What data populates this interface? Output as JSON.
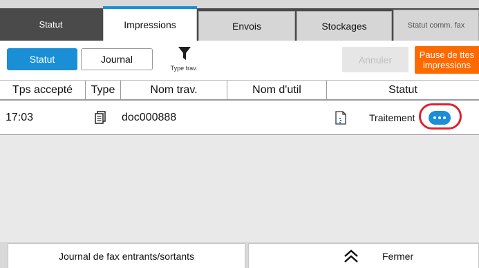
{
  "tabs": [
    {
      "label": "Statut"
    },
    {
      "label": "Impressions"
    },
    {
      "label": "Envois"
    },
    {
      "label": "Stockages"
    },
    {
      "label": "Statut comm. fax"
    }
  ],
  "toolbar": {
    "statut_label": "Statut",
    "journal_label": "Journal",
    "filter_label": "Type trav.",
    "filter_icon": "funnel-icon",
    "annuler_label": "Annuler",
    "pause_label": "Pause de ttes impressions"
  },
  "table": {
    "columns": [
      "Tps accepté",
      "Type",
      "Nom trav.",
      "Nom d'util",
      "Statut"
    ],
    "rows": [
      {
        "time": "17:03",
        "type_icon": "document-stack-icon",
        "job_name": "doc000888",
        "user_name": "",
        "status_icon": "document-processing-icon",
        "status": "Traitement"
      }
    ]
  },
  "bottom": {
    "fax_log_label": "Journal de fax entrants/sortants",
    "close_label": "Fermer",
    "close_icon": "double-chevron-up-icon"
  },
  "colors": {
    "accent": "#1a8fd6",
    "pause": "#ff6a00",
    "highlight": "#e0202a",
    "tabbar": "#4a4a4a"
  }
}
